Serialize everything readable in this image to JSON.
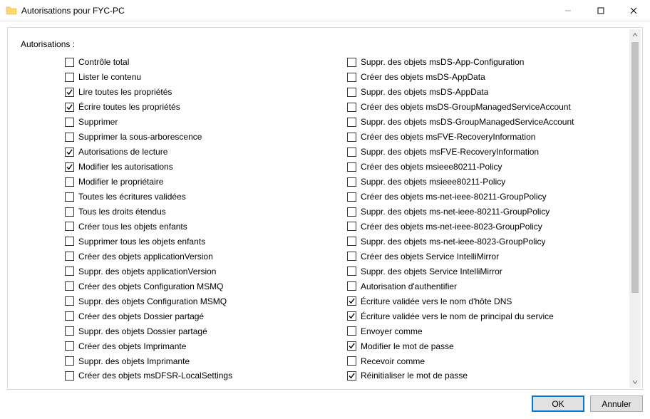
{
  "window": {
    "title": "Autorisations pour FYC-PC"
  },
  "section_label": "Autorisations :",
  "permissions_left": [
    {
      "label": "Contrôle total",
      "checked": false
    },
    {
      "label": "Lister le contenu",
      "checked": false
    },
    {
      "label": "Lire toutes les propriétés",
      "checked": true
    },
    {
      "label": "Écrire toutes les propriétés",
      "checked": true
    },
    {
      "label": "Supprimer",
      "checked": false
    },
    {
      "label": "Supprimer la sous-arborescence",
      "checked": false
    },
    {
      "label": "Autorisations de lecture",
      "checked": true
    },
    {
      "label": "Modifier les autorisations",
      "checked": true
    },
    {
      "label": "Modifier le propriétaire",
      "checked": false
    },
    {
      "label": "Toutes les écritures validées",
      "checked": false
    },
    {
      "label": "Tous les droits étendus",
      "checked": false
    },
    {
      "label": "Créer tous les objets enfants",
      "checked": false
    },
    {
      "label": "Supprimer tous les objets enfants",
      "checked": false
    },
    {
      "label": "Créer des objets applicationVersion",
      "checked": false
    },
    {
      "label": "Suppr. des objets applicationVersion",
      "checked": false
    },
    {
      "label": "Créer des objets Configuration MSMQ",
      "checked": false
    },
    {
      "label": "Suppr. des objets Configuration MSMQ",
      "checked": false
    },
    {
      "label": "Créer des objets Dossier partagé",
      "checked": false
    },
    {
      "label": "Suppr. des objets Dossier partagé",
      "checked": false
    },
    {
      "label": "Créer des objets Imprimante",
      "checked": false
    },
    {
      "label": "Suppr. des objets Imprimante",
      "checked": false
    },
    {
      "label": "Créer des objets msDFSR-LocalSettings",
      "checked": false
    }
  ],
  "permissions_right": [
    {
      "label": "Suppr. des objets msDS-App-Configuration",
      "checked": false
    },
    {
      "label": "Créer des objets msDS-AppData",
      "checked": false
    },
    {
      "label": "Suppr. des objets msDS-AppData",
      "checked": false
    },
    {
      "label": "Créer des objets msDS-GroupManagedServiceAccount",
      "checked": false
    },
    {
      "label": "Suppr. des objets msDS-GroupManagedServiceAccount",
      "checked": false
    },
    {
      "label": "Créer des objets msFVE-RecoveryInformation",
      "checked": false
    },
    {
      "label": "Suppr. des objets msFVE-RecoveryInformation",
      "checked": false
    },
    {
      "label": "Créer des objets msieee80211-Policy",
      "checked": false
    },
    {
      "label": "Suppr. des objets msieee80211-Policy",
      "checked": false
    },
    {
      "label": "Créer des objets ms-net-ieee-80211-GroupPolicy",
      "checked": false
    },
    {
      "label": "Suppr. des objets ms-net-ieee-80211-GroupPolicy",
      "checked": false
    },
    {
      "label": "Créer des objets ms-net-ieee-8023-GroupPolicy",
      "checked": false
    },
    {
      "label": "Suppr. des objets ms-net-ieee-8023-GroupPolicy",
      "checked": false
    },
    {
      "label": "Créer des objets Service IntelliMirror",
      "checked": false
    },
    {
      "label": "Suppr. des objets Service IntelliMirror",
      "checked": false
    },
    {
      "label": "Autorisation d'authentifier",
      "checked": false
    },
    {
      "label": "Écriture validée vers le nom d'hôte DNS",
      "checked": true
    },
    {
      "label": "Écriture validée vers le nom de principal du service",
      "checked": true
    },
    {
      "label": "Envoyer comme",
      "checked": false
    },
    {
      "label": "Modifier le mot de passe",
      "checked": true
    },
    {
      "label": "Recevoir comme",
      "checked": false
    },
    {
      "label": "Réinitialiser le mot de passe",
      "checked": true
    }
  ],
  "buttons": {
    "ok": "OK",
    "cancel": "Annuler"
  }
}
